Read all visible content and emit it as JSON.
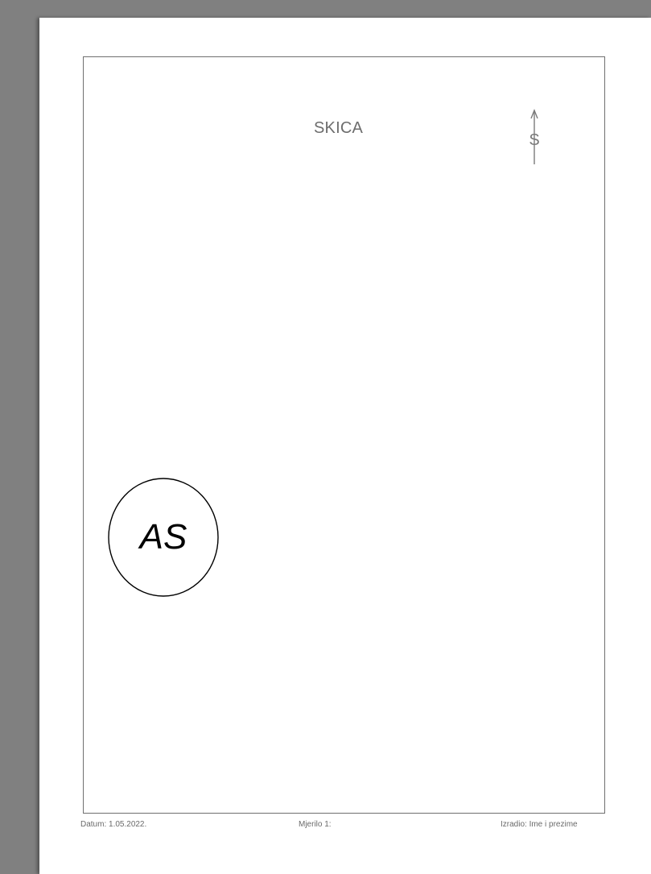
{
  "document": {
    "title": "SKICA",
    "north_symbol": "S",
    "stamp_text": "AS",
    "footer": {
      "date": "Datum: 1.05.2022.",
      "scale": "Mjerilo 1:",
      "author": "Izradio: Ime i prezime"
    }
  },
  "colors": {
    "viewer_background": "#808080",
    "page_background": "#ffffff",
    "frame_line": "#6f6f6f",
    "text_gray": "#6d6d6d",
    "stamp_ink": "#000000"
  },
  "icons": [
    "north-arrow-icon"
  ]
}
